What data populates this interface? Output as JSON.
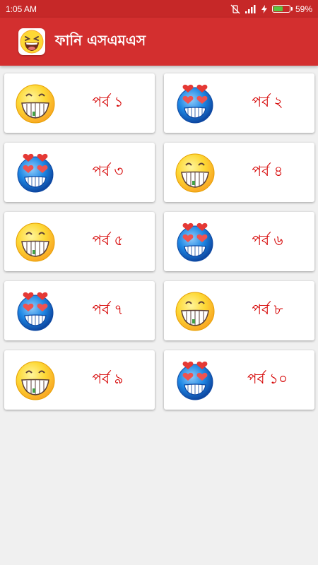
{
  "status_bar": {
    "time": "1:05 AM",
    "battery_percent": "59%",
    "battery_level": 0.59
  },
  "app_bar": {
    "title": "ফানি এসএমএস",
    "icon": "laughing-face-icon"
  },
  "colors": {
    "primary": "#d32f2f",
    "status_bar": "#c62828",
    "label": "#d50000"
  },
  "episodes": [
    {
      "label": "পর্ব ১",
      "icon": "grinning-face-icon"
    },
    {
      "label": "পর্ব ২",
      "icon": "heart-eyes-face-icon"
    },
    {
      "label": "পর্ব ৩",
      "icon": "heart-eyes-face-icon"
    },
    {
      "label": "পর্ব ৪",
      "icon": "grinning-face-icon"
    },
    {
      "label": "পর্ব ৫",
      "icon": "grinning-face-icon"
    },
    {
      "label": "পর্ব ৬",
      "icon": "heart-eyes-face-icon"
    },
    {
      "label": "পর্ব ৭",
      "icon": "heart-eyes-face-icon"
    },
    {
      "label": "পর্ব ৮",
      "icon": "grinning-face-icon"
    },
    {
      "label": "পর্ব ৯",
      "icon": "grinning-face-icon"
    },
    {
      "label": "পর্ব ১০",
      "icon": "heart-eyes-face-icon"
    }
  ]
}
